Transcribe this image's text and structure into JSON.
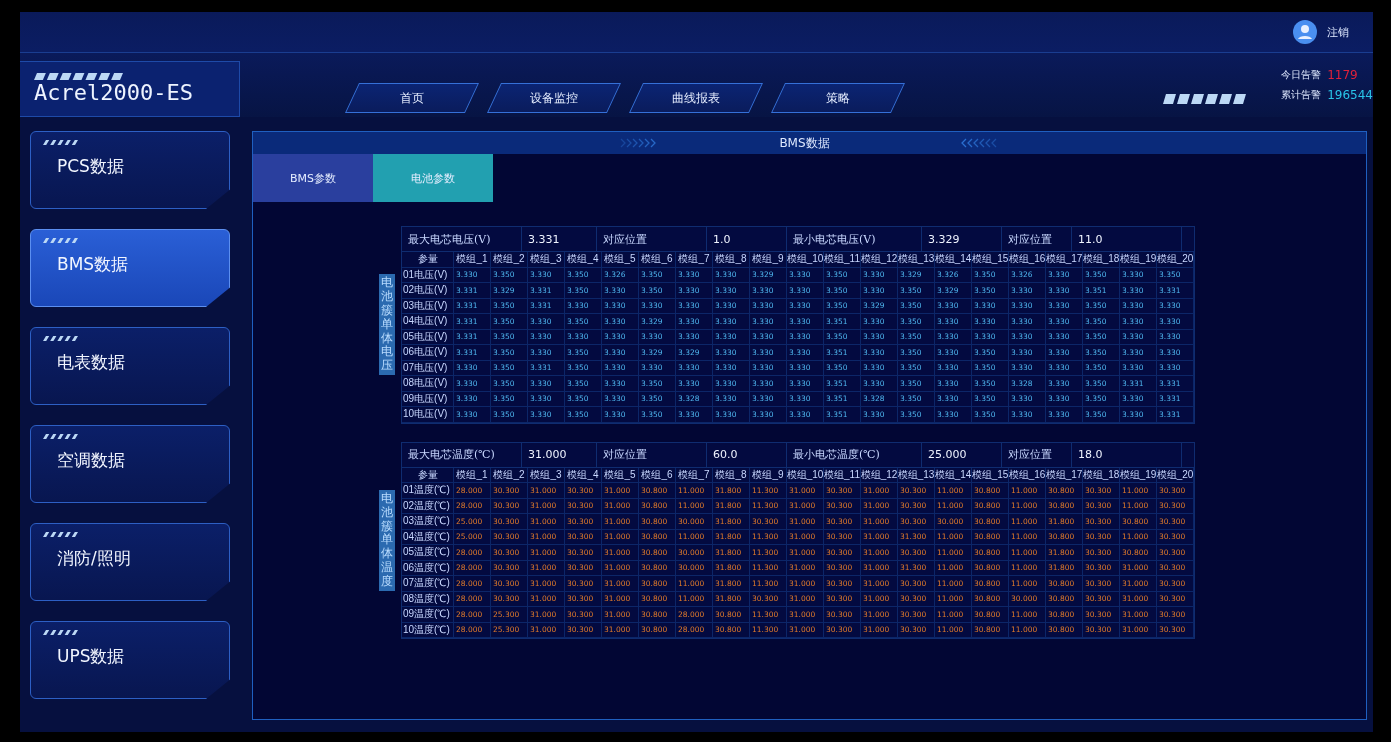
{
  "header": {
    "logo": "Acrel2000-ES",
    "user": "注销",
    "nav": [
      {
        "label": "首页"
      },
      {
        "label": "设备监控"
      },
      {
        "label": "曲线报表"
      },
      {
        "label": "策略"
      }
    ],
    "alarms": [
      {
        "label": "今日告警",
        "value": "1179",
        "color": "#e0203a"
      },
      {
        "label": "累计告警",
        "value": "196544",
        "color": "#29c4e8"
      }
    ]
  },
  "sidebar": {
    "items": [
      {
        "label": "PCS数据",
        "selected": false
      },
      {
        "label": "BMS数据",
        "selected": true
      },
      {
        "label": "电表数据",
        "selected": false
      },
      {
        "label": "空调数据",
        "selected": false
      },
      {
        "label": "消防/照明",
        "selected": false
      },
      {
        "label": "UPS数据",
        "selected": false
      }
    ]
  },
  "panel": {
    "title": "BMS数据",
    "tabs": [
      {
        "label": "BMS参数",
        "selected": false
      },
      {
        "label": "电池参数",
        "selected": true
      }
    ],
    "tables": [
      {
        "kind": "voltage",
        "side_label": "电池簇单体电压",
        "summary": [
          "最大电芯电压(V)",
          "3.331",
          "对应位置",
          "1.0",
          "最小电芯电压(V)",
          "3.329",
          "对应位置",
          "11.0"
        ],
        "corner": "参量",
        "columns": [
          "模组_1",
          "模组_2",
          "模组_3",
          "模组_4",
          "模组_5",
          "模组_6",
          "模组_7",
          "模组_8",
          "模组_9",
          "模组_10",
          "模组_11",
          "模组_12",
          "模组_13",
          "模组_14",
          "模组_15",
          "模组_16",
          "模组_17",
          "模组_18",
          "模组_19",
          "模组_20"
        ],
        "rows": [
          {
            "label": "01电压(V)",
            "values": [
              "3.330",
              "3.350",
              "3.330",
              "3.350",
              "3.326",
              "3.350",
              "3.330",
              "3.330",
              "3.329",
              "3.330",
              "3.350",
              "3.330",
              "3.329",
              "3.326",
              "3.350",
              "3.326",
              "3.330",
              "3.350",
              "3.330",
              "3.350"
            ]
          },
          {
            "label": "02电压(V)",
            "values": [
              "3.331",
              "3.329",
              "3.331",
              "3.350",
              "3.330",
              "3.350",
              "3.330",
              "3.330",
              "3.330",
              "3.330",
              "3.350",
              "3.330",
              "3.350",
              "3.329",
              "3.350",
              "3.330",
              "3.330",
              "3.351",
              "3.330",
              "3.331"
            ]
          },
          {
            "label": "03电压(V)",
            "values": [
              "3.331",
              "3.350",
              "3.331",
              "3.330",
              "3.330",
              "3.330",
              "3.330",
              "3.330",
              "3.330",
              "3.330",
              "3.350",
              "3.329",
              "3.350",
              "3.330",
              "3.330",
              "3.330",
              "3.330",
              "3.350",
              "3.330",
              "3.330"
            ]
          },
          {
            "label": "04电压(V)",
            "values": [
              "3.331",
              "3.350",
              "3.330",
              "3.350",
              "3.330",
              "3.329",
              "3.330",
              "3.330",
              "3.330",
              "3.330",
              "3.351",
              "3.330",
              "3.350",
              "3.330",
              "3.330",
              "3.330",
              "3.330",
              "3.350",
              "3.330",
              "3.330"
            ]
          },
          {
            "label": "05电压(V)",
            "values": [
              "3.331",
              "3.350",
              "3.330",
              "3.330",
              "3.330",
              "3.330",
              "3.330",
              "3.330",
              "3.330",
              "3.330",
              "3.350",
              "3.330",
              "3.350",
              "3.330",
              "3.330",
              "3.330",
              "3.330",
              "3.350",
              "3.330",
              "3.330"
            ]
          },
          {
            "label": "06电压(V)",
            "values": [
              "3.331",
              "3.350",
              "3.330",
              "3.350",
              "3.330",
              "3.329",
              "3.329",
              "3.330",
              "3.330",
              "3.330",
              "3.351",
              "3.330",
              "3.350",
              "3.330",
              "3.350",
              "3.330",
              "3.330",
              "3.350",
              "3.330",
              "3.330"
            ]
          },
          {
            "label": "07电压(V)",
            "values": [
              "3.330",
              "3.350",
              "3.331",
              "3.350",
              "3.330",
              "3.330",
              "3.330",
              "3.330",
              "3.330",
              "3.330",
              "3.350",
              "3.330",
              "3.350",
              "3.330",
              "3.350",
              "3.330",
              "3.330",
              "3.350",
              "3.330",
              "3.330"
            ]
          },
          {
            "label": "08电压(V)",
            "values": [
              "3.330",
              "3.350",
              "3.330",
              "3.350",
              "3.330",
              "3.350",
              "3.330",
              "3.330",
              "3.330",
              "3.330",
              "3.351",
              "3.330",
              "3.350",
              "3.330",
              "3.350",
              "3.328",
              "3.330",
              "3.350",
              "3.331",
              "3.331"
            ]
          },
          {
            "label": "09电压(V)",
            "values": [
              "3.330",
              "3.350",
              "3.330",
              "3.350",
              "3.330",
              "3.350",
              "3.328",
              "3.330",
              "3.330",
              "3.330",
              "3.351",
              "3.328",
              "3.350",
              "3.330",
              "3.350",
              "3.330",
              "3.330",
              "3.350",
              "3.330",
              "3.331"
            ]
          },
          {
            "label": "10电压(V)",
            "values": [
              "3.330",
              "3.350",
              "3.330",
              "3.350",
              "3.330",
              "3.350",
              "3.330",
              "3.330",
              "3.330",
              "3.330",
              "3.351",
              "3.330",
              "3.350",
              "3.330",
              "3.350",
              "3.330",
              "3.330",
              "3.350",
              "3.330",
              "3.331"
            ]
          }
        ]
      },
      {
        "kind": "temperature",
        "side_label": "电池簇单体温度",
        "summary": [
          "最大电芯温度(℃)",
          "31.000",
          "对应位置",
          "60.0",
          "最小电芯温度(℃)",
          "25.000",
          "对应位置",
          "18.0"
        ],
        "corner": "参量",
        "columns": [
          "模组_1",
          "模组_2",
          "模组_3",
          "模组_4",
          "模组_5",
          "模组_6",
          "模组_7",
          "模组_8",
          "模组_9",
          "模组_10",
          "模组_11",
          "模组_12",
          "模组_13",
          "模组_14",
          "模组_15",
          "模组_16",
          "模组_17",
          "模组_18",
          "模组_19",
          "模组_20"
        ],
        "rows": [
          {
            "label": "01温度(℃)",
            "values": [
              "28.000",
              "30.300",
              "31.000",
              "30.300",
              "31.000",
              "30.800",
              "11.000",
              "31.800",
              "11.300",
              "31.000",
              "30.300",
              "31.000",
              "30.300",
              "11.000",
              "30.800",
              "11.000",
              "30.800",
              "30.300",
              "11.000",
              "30.300"
            ]
          },
          {
            "label": "02温度(℃)",
            "values": [
              "28.000",
              "30.300",
              "31.000",
              "30.300",
              "31.000",
              "30.800",
              "11.000",
              "31.800",
              "11.300",
              "31.000",
              "30.300",
              "31.000",
              "30.300",
              "11.000",
              "30.800",
              "11.000",
              "30.800",
              "30.300",
              "11.000",
              "30.300"
            ]
          },
          {
            "label": "03温度(℃)",
            "values": [
              "25.000",
              "30.300",
              "31.000",
              "30.300",
              "31.000",
              "30.800",
              "30.000",
              "31.800",
              "30.300",
              "31.000",
              "30.300",
              "31.000",
              "30.300",
              "30.000",
              "30.800",
              "11.000",
              "31.800",
              "30.300",
              "30.800",
              "30.300"
            ]
          },
          {
            "label": "04温度(℃)",
            "values": [
              "25.000",
              "30.300",
              "31.000",
              "30.300",
              "31.000",
              "30.800",
              "11.000",
              "31.800",
              "11.300",
              "31.000",
              "30.300",
              "31.000",
              "31.300",
              "11.000",
              "30.800",
              "11.000",
              "30.800",
              "30.300",
              "11.000",
              "30.300"
            ]
          },
          {
            "label": "05温度(℃)",
            "values": [
              "28.000",
              "30.300",
              "31.000",
              "30.300",
              "31.000",
              "30.800",
              "30.000",
              "31.800",
              "11.300",
              "31.000",
              "30.300",
              "31.000",
              "30.300",
              "11.000",
              "30.800",
              "11.000",
              "31.800",
              "30.300",
              "30.800",
              "30.300"
            ]
          },
          {
            "label": "06温度(℃)",
            "values": [
              "28.000",
              "30.300",
              "31.000",
              "30.300",
              "31.000",
              "30.800",
              "30.000",
              "31.800",
              "11.300",
              "31.000",
              "30.300",
              "31.000",
              "31.300",
              "11.000",
              "30.800",
              "11.000",
              "31.800",
              "30.300",
              "31.000",
              "30.300"
            ]
          },
          {
            "label": "07温度(℃)",
            "values": [
              "28.000",
              "30.300",
              "31.000",
              "30.300",
              "31.000",
              "30.800",
              "11.000",
              "31.800",
              "11.300",
              "31.000",
              "30.300",
              "31.000",
              "30.300",
              "11.000",
              "30.800",
              "11.000",
              "30.800",
              "30.300",
              "31.000",
              "30.300"
            ]
          },
          {
            "label": "08温度(℃)",
            "values": [
              "28.000",
              "30.300",
              "31.000",
              "30.300",
              "31.000",
              "30.800",
              "11.000",
              "31.800",
              "30.300",
              "31.000",
              "30.300",
              "31.000",
              "30.300",
              "11.000",
              "30.800",
              "30.000",
              "30.800",
              "30.300",
              "31.000",
              "30.300"
            ]
          },
          {
            "label": "09温度(℃)",
            "values": [
              "28.000",
              "25.300",
              "31.000",
              "30.300",
              "31.000",
              "30.800",
              "28.000",
              "30.800",
              "11.300",
              "31.000",
              "30.300",
              "31.000",
              "30.300",
              "11.000",
              "30.800",
              "11.000",
              "30.800",
              "30.300",
              "31.000",
              "30.300"
            ]
          },
          {
            "label": "10温度(℃)",
            "values": [
              "28.000",
              "25.300",
              "31.000",
              "30.300",
              "31.000",
              "30.800",
              "28.000",
              "30.800",
              "11.300",
              "31.000",
              "30.300",
              "31.000",
              "30.300",
              "11.000",
              "30.800",
              "11.000",
              "30.800",
              "30.300",
              "31.000",
              "30.300"
            ]
          }
        ]
      }
    ]
  }
}
